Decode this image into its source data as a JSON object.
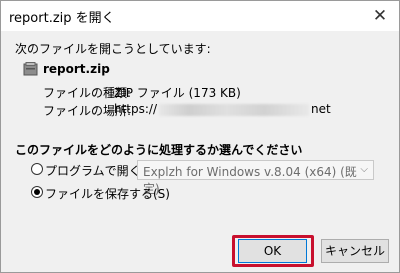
{
  "window": {
    "title": "report.zip を開く"
  },
  "dialog": {
    "prompt": "次のファイルを開こうとしています:",
    "file": {
      "name": "report.zip",
      "type_label": "ファイルの種類:",
      "type_value": "ZIP ファイル (173 KB)",
      "location_label": "ファイルの場所:",
      "location_prefix": "https://",
      "location_suffix": "net"
    },
    "question": "このファイルをどのように処理するか選んでください",
    "options": {
      "open_with_label": "プログラムで開く(O):",
      "open_with_app": "Explzh for Windows v.8.04 (x64) (既定)",
      "save_label": "ファイルを保存する(S)",
      "selected": "save"
    }
  },
  "buttons": {
    "ok": "OK",
    "cancel": "キャンセル"
  },
  "colors": {
    "highlight": "#c8102e",
    "focus": "#0078d7"
  }
}
